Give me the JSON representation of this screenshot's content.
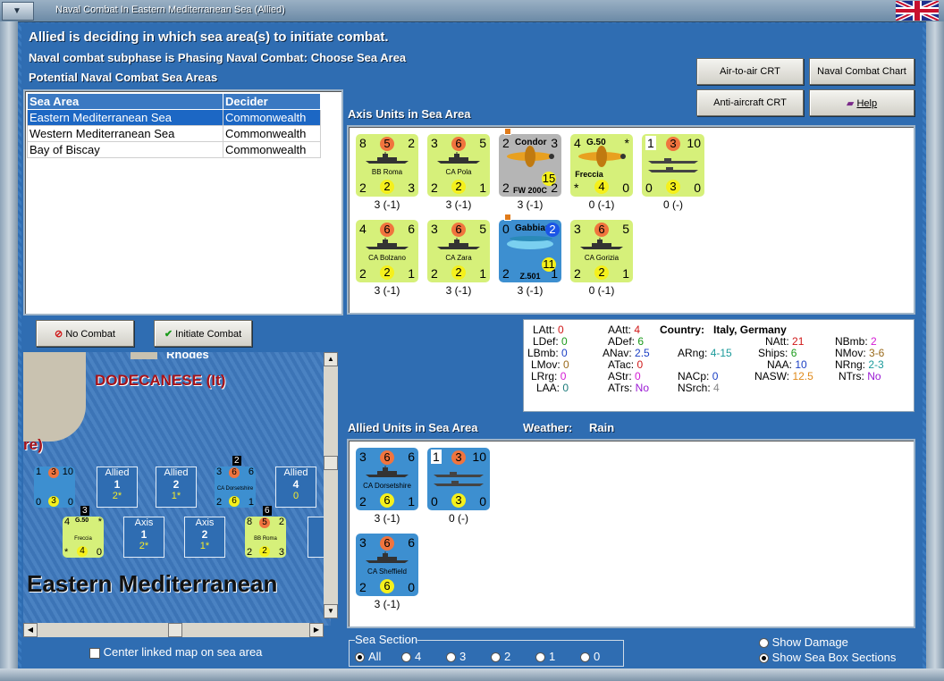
{
  "window": {
    "title": "Naval Combat In Eastern Mediterranean Sea (Allied)"
  },
  "header": {
    "line1": "Allied is deciding in which sea area(s) to initiate combat.",
    "line2": "Naval combat subphase is Phasing Naval Combat: Choose Sea Area",
    "line3": "Potential Naval Combat Sea Areas"
  },
  "buttons": {
    "air_to_air": "Air-to-air CRT",
    "naval_chart": "Naval Combat Chart",
    "anti_aircraft": "Anti-aircraft CRT",
    "help": "Help",
    "no_combat": "No Combat",
    "initiate_combat": "Initiate Combat"
  },
  "sea_table": {
    "headers": [
      "Sea Area",
      "Decider"
    ],
    "rows": [
      {
        "area": "Eastern Mediterranean Sea",
        "decider": "Commonwealth"
      },
      {
        "area": "Western Mediterranean Sea",
        "decider": "Commonwealth"
      },
      {
        "area": "Bay of Biscay",
        "decider": "Commonwealth"
      }
    ]
  },
  "axis": {
    "title": "Axis Units in Sea Area",
    "units": [
      {
        "tl": "8",
        "tc": "5",
        "tr": "2",
        "name": "BB Roma",
        "bl": "2",
        "bc": "2",
        "br": "3",
        "label": "3 (-1)"
      },
      {
        "tl": "3",
        "tc": "6",
        "tr": "5",
        "name": "CA Pola",
        "bl": "2",
        "bc": "2",
        "br": "1",
        "label": "3 (-1)"
      },
      {
        "tl": "2",
        "top": "Condor",
        "tr": "3",
        "mid": "15",
        "bl": "2",
        "name": "FW 200C",
        "br": "2",
        "label": "3 (-1)"
      },
      {
        "tl": "4",
        "top": "G.50",
        "tr": "*",
        "name": "Freccia",
        "bl": "*",
        "bc": "4",
        "br": "0",
        "label": "0 (-1)"
      },
      {
        "tl": "1",
        "tc": "3",
        "tr": "10",
        "bl": "0",
        "bc": "3",
        "br": "0",
        "label": "0 (-)"
      },
      {
        "tl": "4",
        "tc": "6",
        "tr": "6",
        "name": "CA Bolzano",
        "bl": "2",
        "bc": "2",
        "br": "1",
        "label": "3 (-1)"
      },
      {
        "tl": "3",
        "tc": "6",
        "tr": "5",
        "name": "CA Zara",
        "bl": "2",
        "bc": "2",
        "br": "1",
        "label": "3 (-1)"
      },
      {
        "tl": "0",
        "top": "Gabbiano",
        "tr": "2",
        "mid": "11",
        "bl": "2",
        "name": "Z.501",
        "br": "1",
        "label": "3 (-1)"
      },
      {
        "tl": "3",
        "tc": "6",
        "tr": "5",
        "name": "CA Gorizia",
        "bl": "2",
        "bc": "2",
        "br": "1",
        "label": "0 (-1)"
      }
    ]
  },
  "allied": {
    "title": "Allied Units in Sea Area",
    "weather_label": "Weather:",
    "weather": "Rain",
    "units": [
      {
        "tl": "3",
        "tc": "6",
        "tr": "6",
        "name": "CA Dorsetshire",
        "bl": "2",
        "bc": "6",
        "br": "1",
        "label": "3 (-1)"
      },
      {
        "tl": "1",
        "tc": "3",
        "tr": "10",
        "bl": "0",
        "bc": "3",
        "br": "0",
        "label": "0 (-)"
      },
      {
        "tl": "3",
        "tc": "6",
        "tr": "6",
        "name": "CA Sheffield",
        "bl": "2",
        "bc": "6",
        "br": "0",
        "label": "3 (-1)"
      }
    ]
  },
  "stats": {
    "country_label": "Country:",
    "country": "Italy, Germany",
    "items": [
      {
        "k": "LAtt:",
        "v": "0",
        "c": "#d01818"
      },
      {
        "k": "LDef:",
        "v": "0",
        "c": "#1a9a1a"
      },
      {
        "k": "LBmb:",
        "v": "0",
        "c": "#1b3fc4"
      },
      {
        "k": "LMov:",
        "v": "0",
        "c": "#9a6a1a"
      },
      {
        "k": "LRrg:",
        "v": "0",
        "c": "#d41bd4"
      },
      {
        "k": "LAA:",
        "v": "0",
        "c": "#1a7a7a"
      },
      {
        "k": "AAtt:",
        "v": "4",
        "c": "#d01818"
      },
      {
        "k": "ADef:",
        "v": "6",
        "c": "#1a9a1a"
      },
      {
        "k": "ANav:",
        "v": "2.5",
        "c": "#1b3fc4"
      },
      {
        "k": "ATac:",
        "v": "0",
        "c": "#d01818"
      },
      {
        "k": "AStr:",
        "v": "0",
        "c": "#d41bd4"
      },
      {
        "k": "ATrs:",
        "v": "No",
        "c": "#9a1ad4"
      },
      {
        "k": "ARng:",
        "v": "4-15",
        "c": "#1a9a9a"
      },
      {
        "k": "NACp:",
        "v": "0",
        "c": "#1b3fc4"
      },
      {
        "k": "NSrch:",
        "v": "4",
        "c": "#888888"
      },
      {
        "k": "NAtt:",
        "v": "21",
        "c": "#d01818"
      },
      {
        "k": "Ships:",
        "v": "6",
        "c": "#1a9a1a"
      },
      {
        "k": "NAA:",
        "v": "10",
        "c": "#1b3fc4"
      },
      {
        "k": "NASW:",
        "v": "12.5",
        "c": "#e08a1a"
      },
      {
        "k": "NBmb:",
        "v": "2",
        "c": "#d41bd4"
      },
      {
        "k": "NMov:",
        "v": "3-6",
        "c": "#9a6a1a"
      },
      {
        "k": "NRng:",
        "v": "2-3",
        "c": "#1a9a9a"
      },
      {
        "k": "NTrs:",
        "v": "No",
        "c": "#9a1ad4"
      }
    ]
  },
  "map": {
    "rhodes": "Rhodes",
    "dodecanese": "DODECANESE (It)",
    "partial": "re)",
    "sea_name": "Eastern Mediterranean",
    "boxes": [
      {
        "top": "Allied",
        "mid": "1",
        "bot": "2*"
      },
      {
        "top": "Allied",
        "mid": "2",
        "bot": "1*"
      },
      {
        "top": "Allied",
        "mid": "4",
        "bot": "0"
      },
      {
        "top": "Axis",
        "mid": "1",
        "bot": "2*"
      },
      {
        "top": "Axis",
        "mid": "2",
        "bot": "1*"
      },
      {
        "top": "A",
        "mid": "",
        "bot": ""
      }
    ],
    "stack_counts": [
      "2",
      "3",
      "6"
    ],
    "mini_units": [
      {
        "tl": "1",
        "tc": "3",
        "tr": "10",
        "bl": "0",
        "bc": "3",
        "br": "0"
      },
      {
        "tl": "3",
        "tc": "6",
        "tr": "6",
        "name": "CA Dorsetshire",
        "bl": "2",
        "bc": "6",
        "br": "1"
      },
      {
        "tl": "4",
        "top": "G.50",
        "tr": "*",
        "name": "Freccia",
        "bl": "*",
        "bc": "4",
        "br": "0"
      },
      {
        "tl": "8",
        "tc": "5",
        "tr": "2",
        "name": "BB Roma",
        "bl": "2",
        "bc": "2",
        "br": "3"
      }
    ]
  },
  "center_map": "Center linked map on sea area",
  "sea_section": {
    "title": "Sea Section",
    "options": [
      "All",
      "4",
      "3",
      "2",
      "1",
      "0"
    ]
  },
  "options": {
    "show_damage": "Show Damage",
    "show_sections": "Show Sea Box Sections"
  }
}
